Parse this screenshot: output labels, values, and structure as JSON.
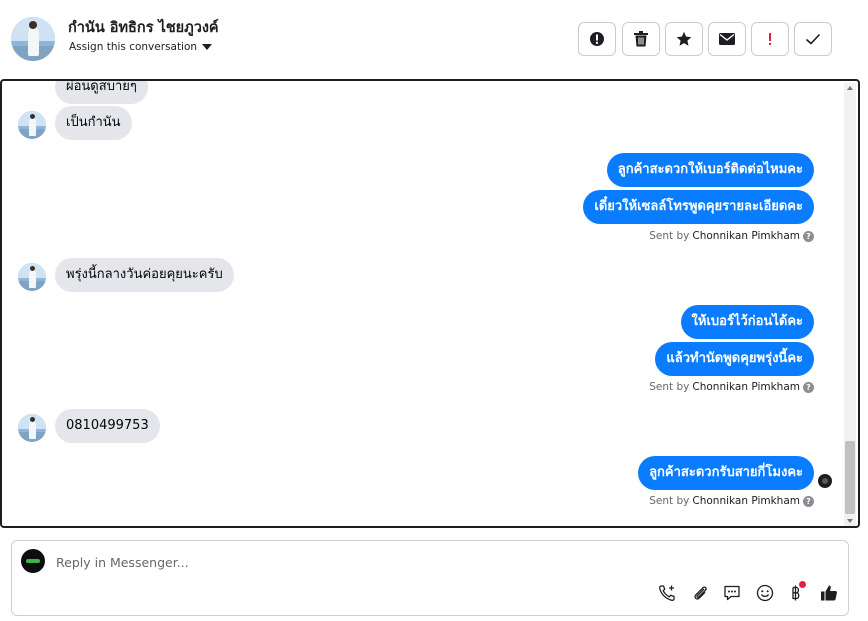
{
  "header": {
    "name": "กำนัน อิทธิกร ไชยภูวงค์",
    "assign_label": "Assign this conversation",
    "actions": [
      {
        "name": "report-spam",
        "icon": "exclamation-circle-icon"
      },
      {
        "name": "delete",
        "icon": "trash-icon"
      },
      {
        "name": "star",
        "icon": "star-icon"
      },
      {
        "name": "mark-unread",
        "icon": "envelope-icon"
      },
      {
        "name": "follow-up",
        "icon": "exclamation-icon",
        "color": "#e41e3f"
      },
      {
        "name": "mark-done",
        "icon": "check-icon"
      }
    ]
  },
  "messages": {
    "partial_top": "ผ่อนดูสบายๆ",
    "in_1": "เป็นกำนัน",
    "out_1a": "ลูกค้าสะดวกให้เบอร์ติดต่อไหมคะ",
    "out_1b": "เดี๋ยวให้เซลล์โทรพูดคุยรายละเอียดคะ",
    "in_2": "พรุ่งนี้กลางวันค่อยคุยนะครับ",
    "out_2a": "ให้เบอร์ไว้ก่อนได้คะ",
    "out_2b": "แล้วทำนัดพูดคุยพรุ่งนี้คะ",
    "in_3": "0810499753",
    "out_3a": "ลูกค้าสะดวกรับสายกี่โมงคะ",
    "sent_by_prefix": "Sent by",
    "sent_by_name": "Chonnikan Pimkham"
  },
  "composer": {
    "placeholder": "Reply in Messenger...",
    "tools": [
      "phone-plus-icon",
      "paperclip-icon",
      "saved-reply-icon",
      "emoji-icon",
      "baht-icon",
      "thumbs-up-icon"
    ]
  },
  "colors": {
    "outgoing_bubble": "#0a7cff",
    "incoming_bubble": "#e4e6eb",
    "alert_red": "#e41e3f"
  }
}
